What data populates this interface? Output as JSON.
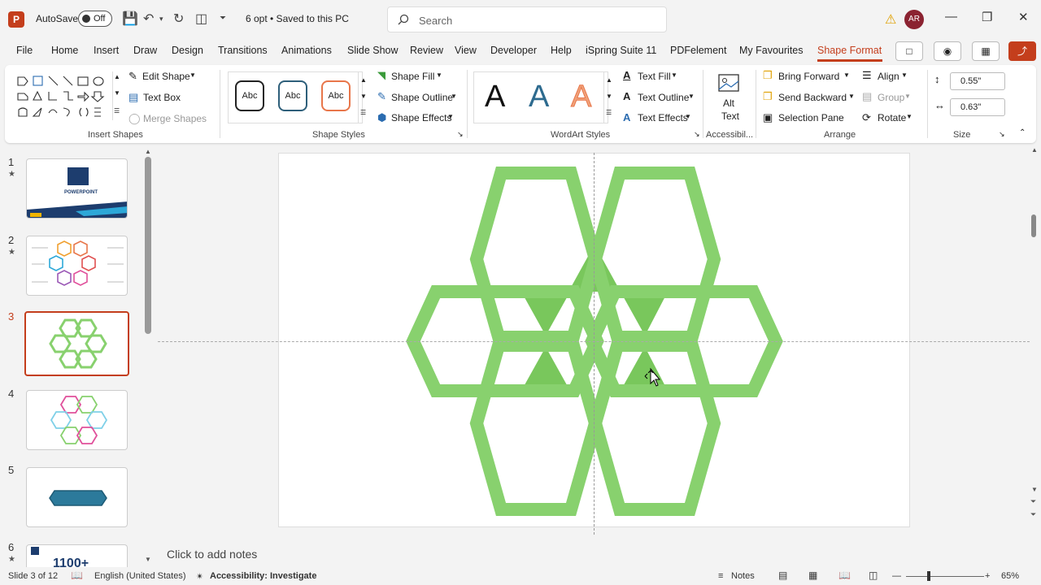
{
  "titlebar": {
    "app_logo": "P",
    "autosave_label": "AutoSave",
    "autosave_state": "Off",
    "document_title": "6 opt • Saved to this PC",
    "search_placeholder": "Search",
    "user_initials": "AR"
  },
  "tabs": [
    "File",
    "Home",
    "Insert",
    "Draw",
    "Design",
    "Transitions",
    "Animations",
    "Slide Show",
    "Review",
    "View",
    "Developer",
    "Help",
    "iSpring Suite 11",
    "PDFelement",
    "My Favourites",
    "Shape Format"
  ],
  "active_tab": "Shape Format",
  "ribbon": {
    "insert_shapes": {
      "label": "Insert Shapes",
      "edit_shape": "Edit Shape",
      "text_box": "Text Box",
      "merge_shapes": "Merge Shapes"
    },
    "shape_styles": {
      "label": "Shape Styles",
      "presets": [
        "Abc",
        "Abc",
        "Abc"
      ],
      "preset_colors": [
        "#222222",
        "#2e5f7a",
        "#e8764a"
      ],
      "shape_fill": "Shape Fill",
      "shape_outline": "Shape Outline",
      "shape_effects": "Shape Effects"
    },
    "wordart_styles": {
      "label": "WordArt Styles",
      "presets": [
        "A",
        "A",
        "A"
      ],
      "preset_colors": [
        "#111111",
        "#2e6b8f",
        "#f0a27a"
      ],
      "text_fill": "Text Fill",
      "text_outline": "Text Outline",
      "text_effects": "Text Effects"
    },
    "accessibility": {
      "label": "Accessibil...",
      "alt_text_line1": "Alt",
      "alt_text_line2": "Text"
    },
    "arrange": {
      "label": "Arrange",
      "bring_forward": "Bring Forward",
      "send_backward": "Send Backward",
      "selection_pane": "Selection Pane",
      "align": "Align",
      "group": "Group",
      "rotate": "Rotate"
    },
    "size": {
      "label": "Size",
      "height": "0.55\"",
      "width": "0.63\""
    }
  },
  "slides": [
    {
      "number": "1",
      "starred": true
    },
    {
      "number": "2",
      "starred": true
    },
    {
      "number": "3",
      "starred": false,
      "active": true
    },
    {
      "number": "4",
      "starred": false
    },
    {
      "number": "5",
      "starred": false
    },
    {
      "number": "6",
      "starred": true
    }
  ],
  "thumb1_title": "POWERPOINT",
  "thumb6_text": "1100+",
  "slide_canvas": {
    "shape_color": "#88d16e",
    "overlap_color": "#79c75c"
  },
  "notes_placeholder": "Click to add notes",
  "status": {
    "slide_info": "Slide 3 of 12",
    "language": "English (United States)",
    "accessibility": "Accessibility: Investigate",
    "notes": "Notes",
    "zoom": "65%"
  }
}
